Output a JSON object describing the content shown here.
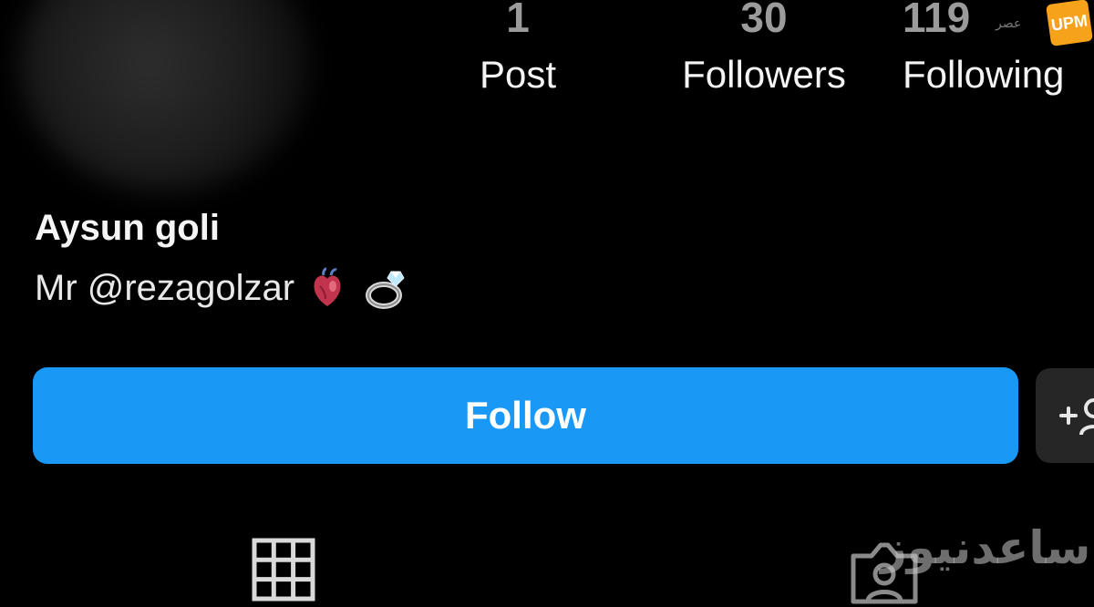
{
  "stats": {
    "posts": {
      "value": "1",
      "label": "Post"
    },
    "followers": {
      "value": "30",
      "label": "Followers"
    },
    "following": {
      "value": "119",
      "label": "Following"
    }
  },
  "profile": {
    "name": "Aysun goli",
    "bio_text": "Mr @rezagolzar",
    "bio_emojis": [
      "anatomical-heart",
      "ring"
    ]
  },
  "actions": {
    "follow_label": "Follow",
    "suggest_icon": "add-person-icon"
  },
  "tabs": [
    {
      "icon": "grid-icon"
    },
    {
      "icon": "tagged-person-icon"
    }
  ],
  "watermarks": {
    "top_logo": "UPM",
    "top_small_text": "عصر",
    "bottom_text": "ساعدنیوز"
  },
  "colors": {
    "background": "#000000",
    "follow_button": "#1a98f5",
    "secondary_button": "#262626",
    "stat_value": "#9b9b9b"
  }
}
